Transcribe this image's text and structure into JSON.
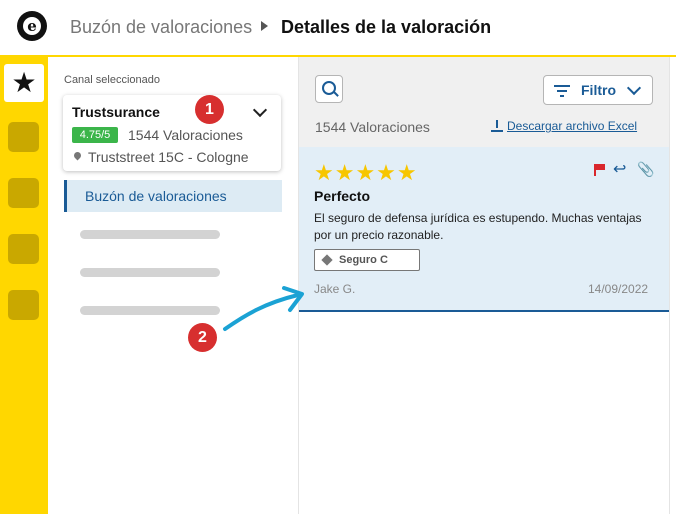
{
  "header": {
    "breadcrumb_parent": "Buzón de valoraciones",
    "breadcrumb_current": "Detalles de la valoración"
  },
  "sidebar": {
    "channel_label": "Canal seleccionado",
    "channel": {
      "name": "Trustsurance",
      "score": "4.75/5",
      "reviews_count": "1544 Valoraciones",
      "address": "Truststreet 15C - Cologne"
    },
    "nav_active": "Buzón de valoraciones"
  },
  "toolbar": {
    "filter_label": "Filtro"
  },
  "list": {
    "count_text": "1544 Valoraciones",
    "download_label": "Descargar archivo Excel"
  },
  "review": {
    "rating": 5,
    "stars": "★★★★★",
    "title": "Perfecto",
    "text": "El seguro de defensa jurídica es estupendo. Muchas ventajas por un precio razonable.",
    "tag": "Seguro C",
    "author": "Jake G.",
    "date": "14/09/2022"
  },
  "annotations": {
    "marker_1": "1",
    "marker_2": "2"
  },
  "colors": {
    "brand_yellow": "#FFD700",
    "accent_blue": "#1A5B96",
    "badge_green": "#3BB54A",
    "marker_red": "#D72F2F",
    "star_yellow": "#F7C600"
  }
}
